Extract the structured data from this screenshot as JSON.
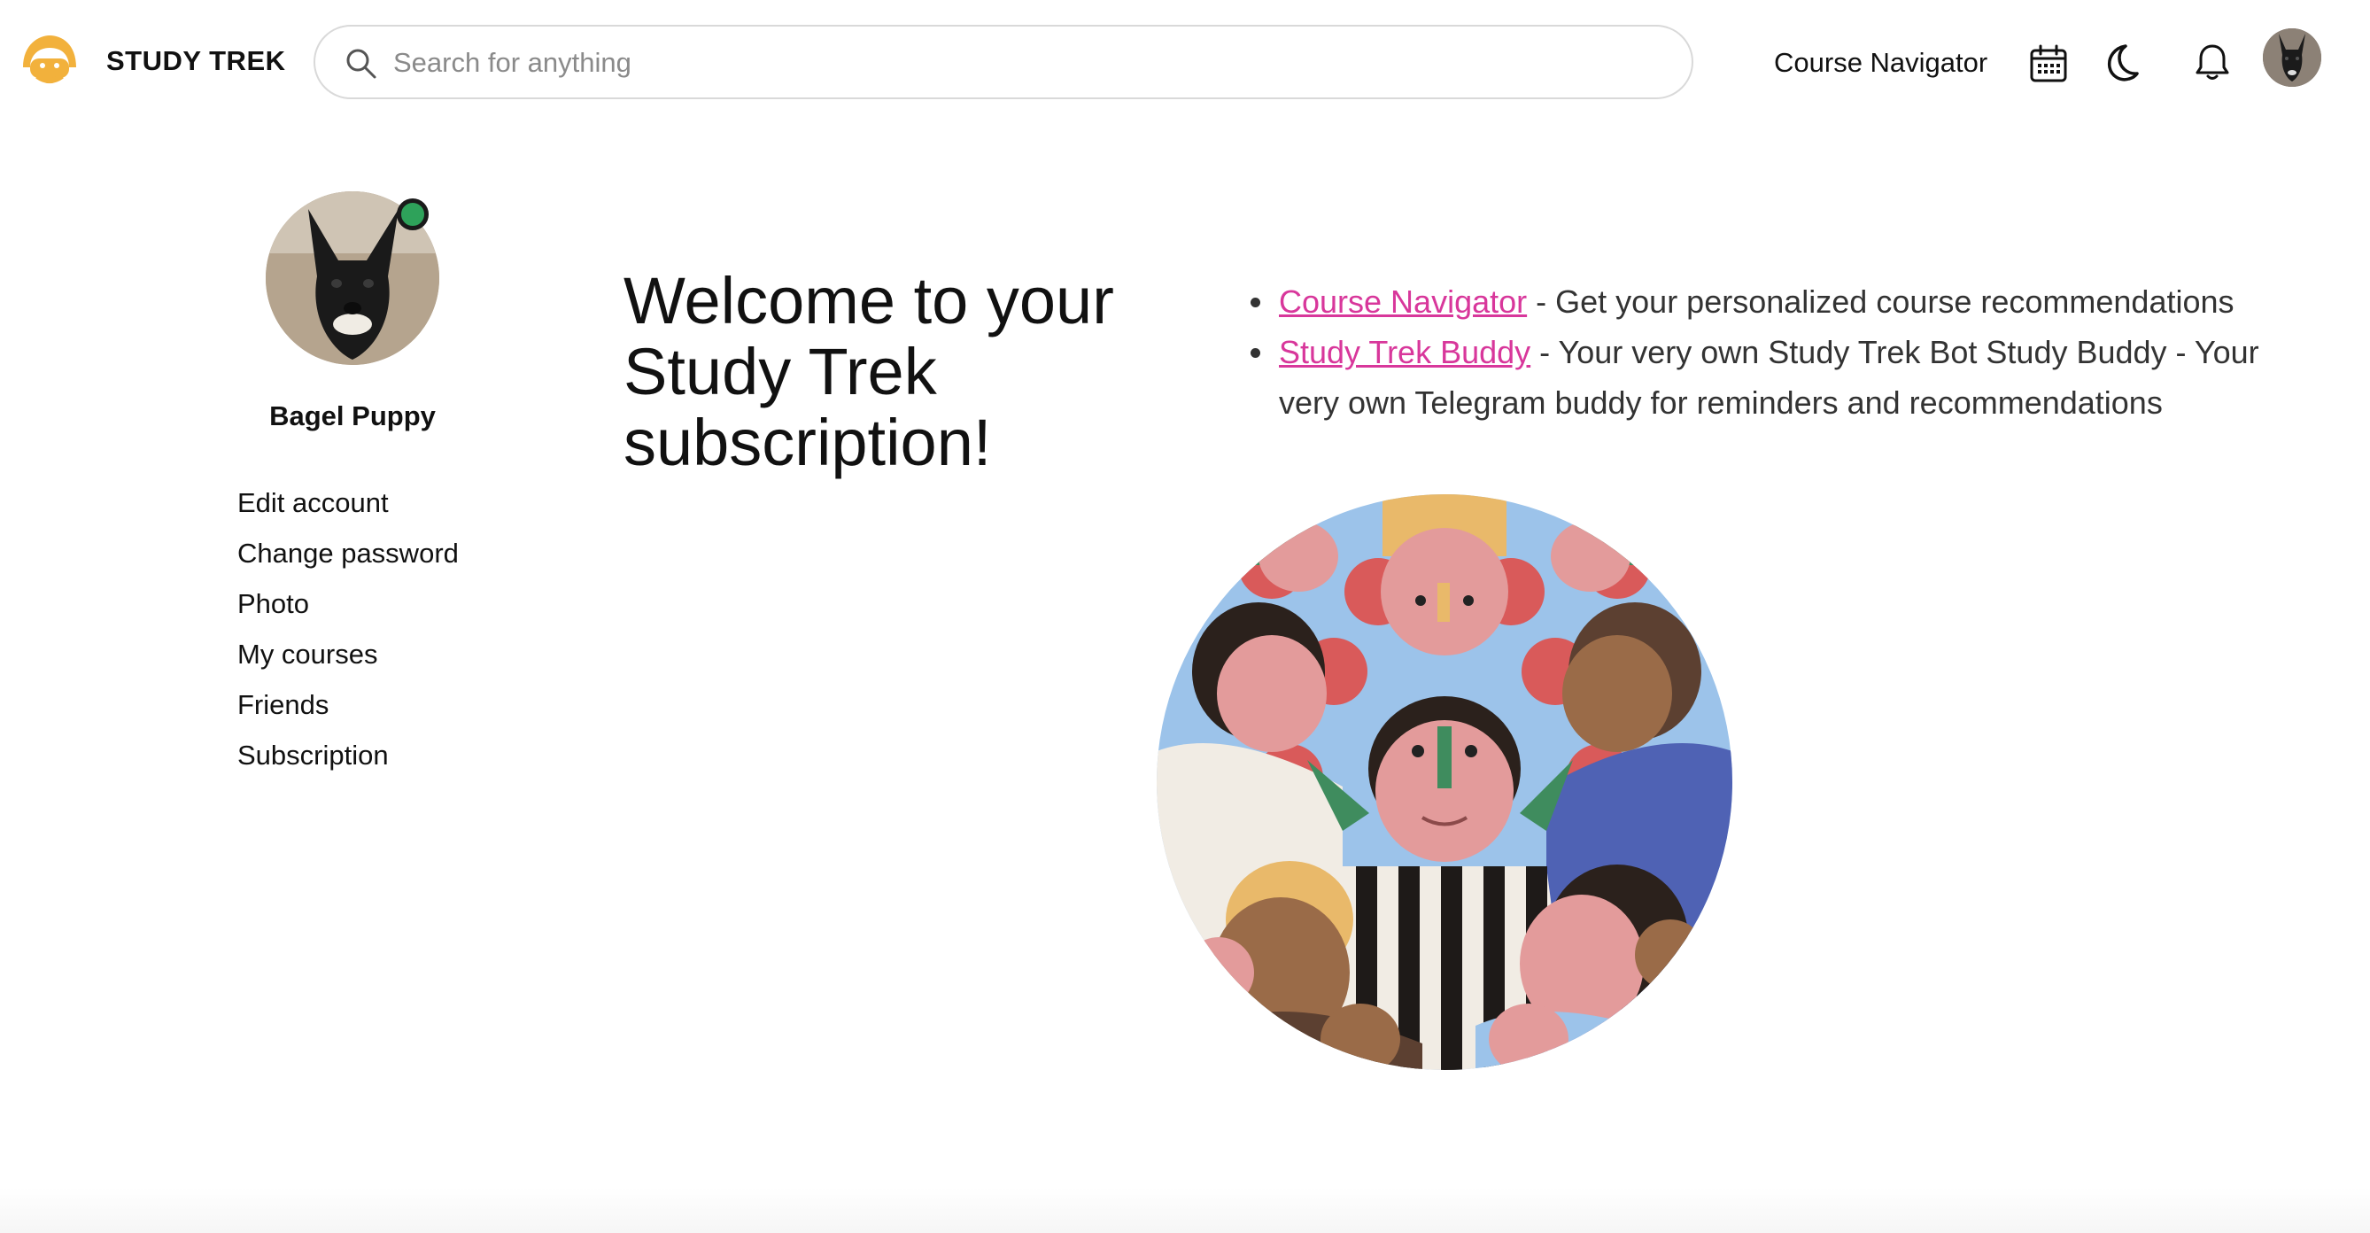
{
  "header": {
    "brand": "STUDY TREK",
    "search_placeholder": "Search for anything",
    "nav_link": "Course Navigator",
    "icons": [
      "calendar-icon",
      "moon-icon",
      "bell-icon"
    ]
  },
  "sidebar": {
    "user_name": "Bagel Puppy",
    "status": "online",
    "menu": [
      "Edit account",
      "Change password",
      "Photo",
      "My courses",
      "Friends",
      "Subscription"
    ]
  },
  "main": {
    "welcome": "Welcome to your Study Trek subscription!",
    "features": [
      {
        "link": "Course Navigator",
        "text": " - Get your personalized course recommendations"
      },
      {
        "link": "Study Trek Buddy",
        "text": " - Your very own Study Trek Bot Study Buddy - Your very own Telegram buddy for reminders and recommendations"
      }
    ]
  },
  "colors": {
    "link": "#d8379b",
    "online": "#2ea25a",
    "logo": "#f2b13c"
  }
}
